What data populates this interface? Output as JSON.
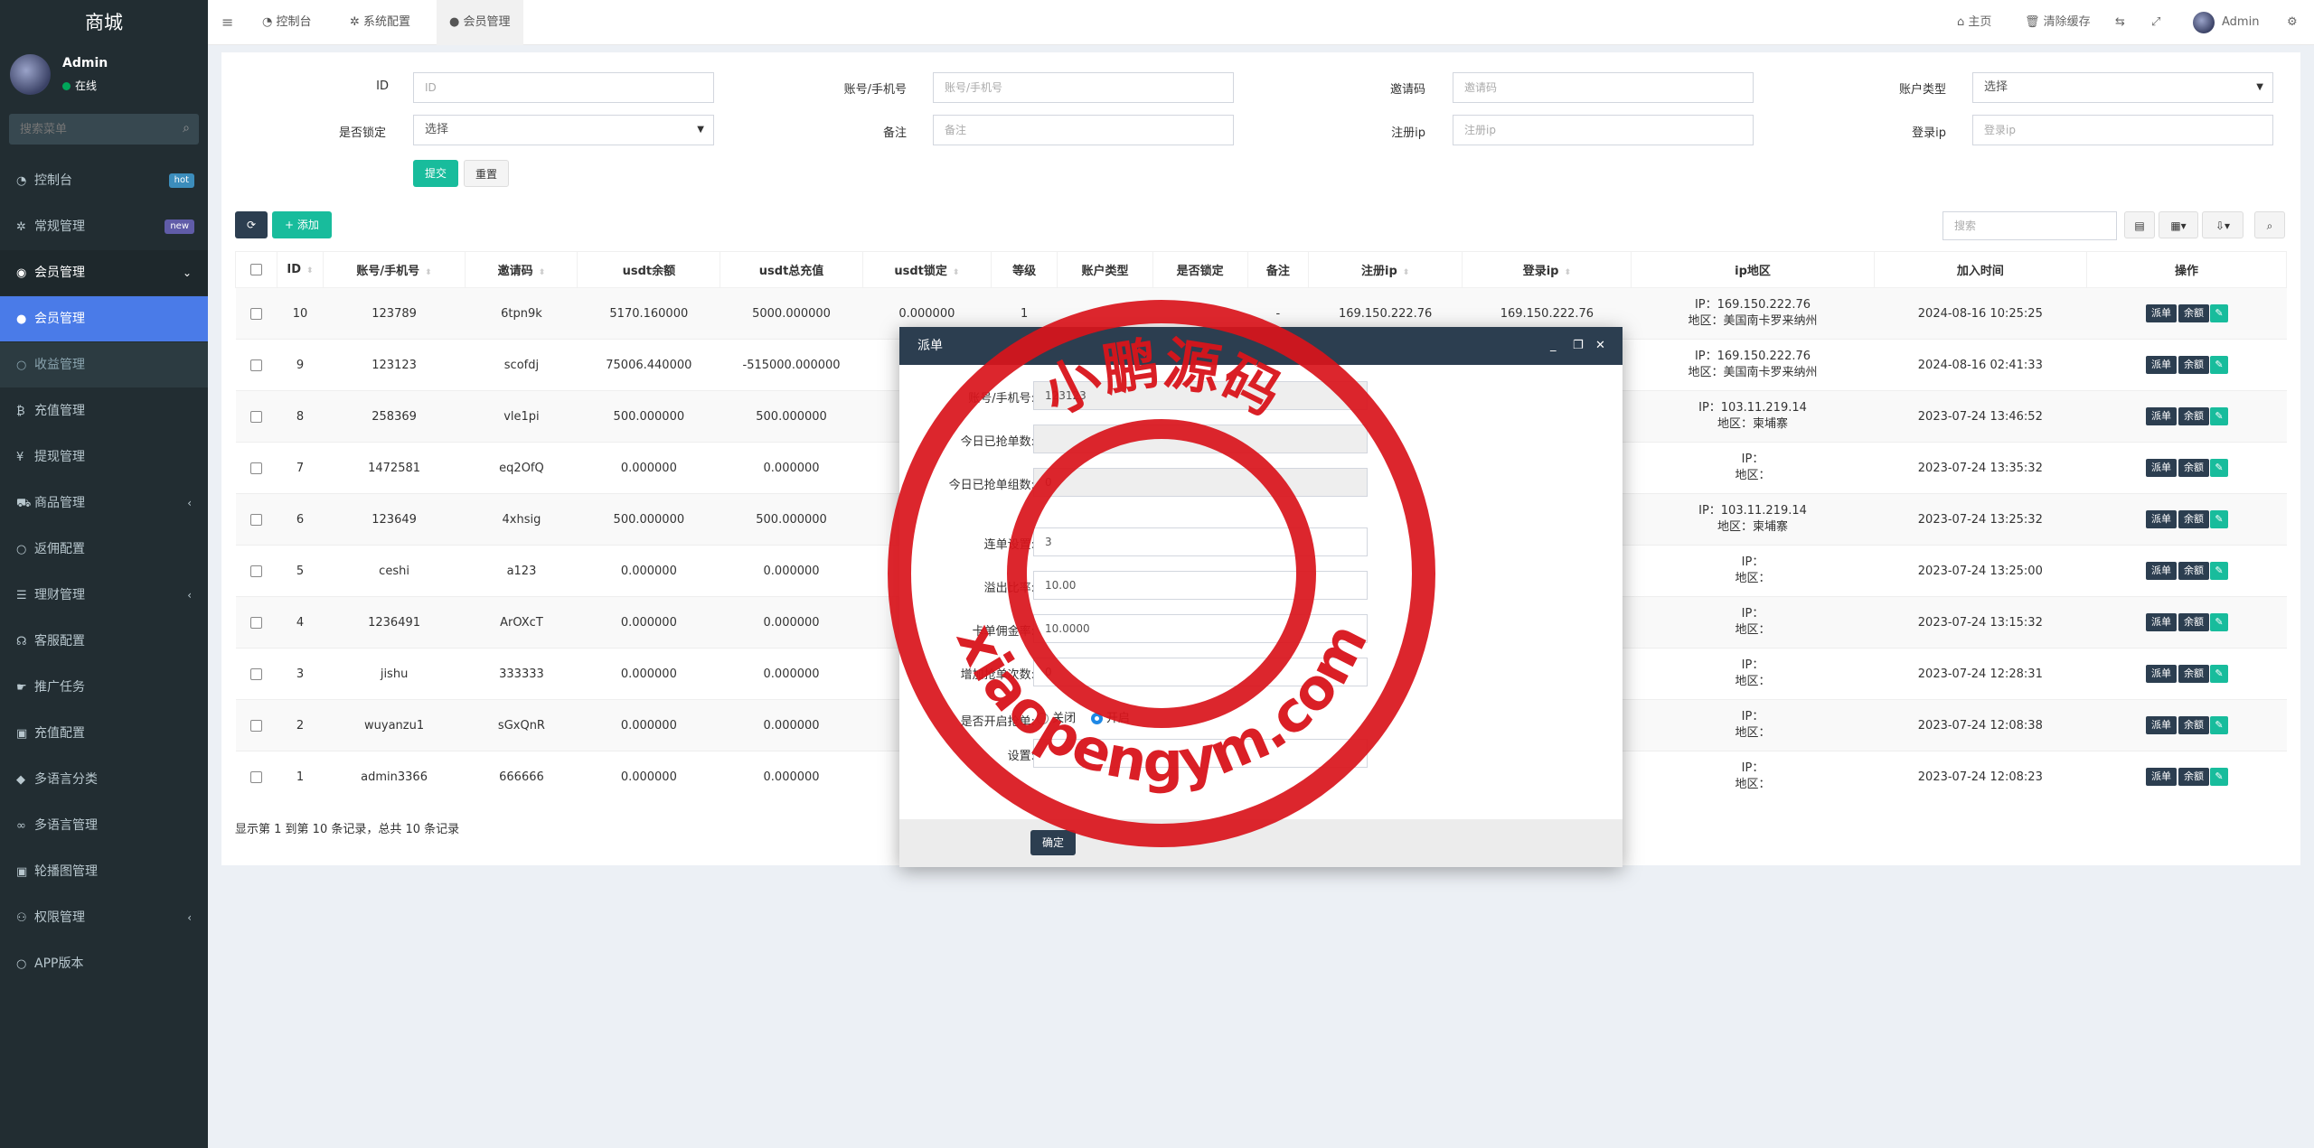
{
  "sidebar": {
    "logo": "商城",
    "user": {
      "name": "Admin",
      "status": "在线"
    },
    "search_placeholder": "搜索菜单",
    "items": [
      {
        "label": "控制台",
        "icon": "dashboard-icon",
        "badge": "hot",
        "badge_color": "#3c8dbc"
      },
      {
        "label": "常规管理",
        "icon": "cogs-icon",
        "badge": "new",
        "badge_color": "#605ca8"
      },
      {
        "label": "会员管理",
        "icon": "user-circle-icon",
        "expanded": true
      },
      {
        "label": "会员管理",
        "icon": "user-icon",
        "sub": true,
        "active": true
      },
      {
        "label": "收益管理",
        "icon": "circle-icon",
        "sub": true
      },
      {
        "label": "充值管理",
        "icon": "bitcoin-icon"
      },
      {
        "label": "提现管理",
        "icon": "yen-icon"
      },
      {
        "label": "商品管理",
        "icon": "cart-icon",
        "has_arrow": true
      },
      {
        "label": "返佣配置",
        "icon": "circle-icon"
      },
      {
        "label": "理财管理",
        "icon": "list-icon",
        "has_arrow": true
      },
      {
        "label": "客服配置",
        "icon": "headset-icon"
      },
      {
        "label": "推广任务",
        "icon": "hand-icon"
      },
      {
        "label": "充值配置",
        "icon": "image-icon"
      },
      {
        "label": "多语言分类",
        "icon": "tag-icon"
      },
      {
        "label": "多语言管理",
        "icon": "link-icon"
      },
      {
        "label": "轮播图管理",
        "icon": "image-icon"
      },
      {
        "label": "权限管理",
        "icon": "group-icon",
        "has_arrow": true
      },
      {
        "label": "APP版本",
        "icon": "circle-icon"
      }
    ]
  },
  "header": {
    "tabs": [
      {
        "label": "控制台",
        "icon": "dashboard-icon"
      },
      {
        "label": "系统配置",
        "icon": "gear-icon"
      },
      {
        "label": "会员管理",
        "icon": "user-icon",
        "active": true
      }
    ],
    "home": "主页",
    "clear_cache": "清除缓存",
    "admin": "Admin"
  },
  "filters": {
    "id": {
      "label": "ID",
      "placeholder": "ID"
    },
    "account": {
      "label": "账号/手机号",
      "placeholder": "账号/手机号"
    },
    "invite": {
      "label": "邀请码",
      "placeholder": "邀请码"
    },
    "account_type": {
      "label": "账户类型",
      "value": "选择"
    },
    "locked": {
      "label": "是否锁定",
      "value": "选择"
    },
    "remark": {
      "label": "备注",
      "placeholder": "备注"
    },
    "reg_ip": {
      "label": "注册ip",
      "placeholder": "注册ip"
    },
    "login_ip": {
      "label": "登录ip",
      "placeholder": "登录ip"
    },
    "submit": "提交",
    "reset": "重置"
  },
  "toolbar": {
    "add": "添加",
    "search_placeholder": "搜索"
  },
  "table": {
    "headers": [
      "ID",
      "账号/手机号",
      "邀请码",
      "usdt余额",
      "usdt总充值",
      "usdt锁定",
      "等级",
      "账户类型",
      "是否锁定",
      "备注",
      "注册ip",
      "登录ip",
      "ip地区",
      "加入时间",
      "操作"
    ],
    "rows": [
      {
        "id": "10",
        "account": "123789",
        "code": "6tpn9k",
        "balance": "5170.160000",
        "total": "5000.000000",
        "locked_amt": "0.000000",
        "reg_ip": "169.150.222.76",
        "login_ip": "169.150.222.76",
        "ip1": "IP：169.150.222.76",
        "ip2": "地区：美国南卡罗来纳州",
        "time": "2024-08-16 10:25:25"
      },
      {
        "id": "9",
        "account": "123123",
        "code": "scofdj",
        "balance": "75006.440000",
        "total": "-515000.000000",
        "locked_amt": "",
        "reg_ip": "",
        "login_ip": "76",
        "ip1": "IP：169.150.222.76",
        "ip2": "地区：美国南卡罗来纳州",
        "time": "2024-08-16 02:41:33"
      },
      {
        "id": "8",
        "account": "258369",
        "code": "vle1pi",
        "balance": "500.000000",
        "total": "500.000000",
        "locked_amt": "",
        "reg_ip": "",
        "login_ip": "14",
        "ip1": "IP：103.11.219.14",
        "ip2": "地区：柬埔寨",
        "time": "2023-07-24 13:46:52"
      },
      {
        "id": "7",
        "account": "1472581",
        "code": "eq2OfQ",
        "balance": "0.000000",
        "total": "0.000000",
        "locked_amt": "",
        "reg_ip": "",
        "login_ip": "",
        "ip1": "IP：",
        "ip2": "地区：",
        "time": "2023-07-24 13:35:32"
      },
      {
        "id": "6",
        "account": "123649",
        "code": "4xhsig",
        "balance": "500.000000",
        "total": "500.000000",
        "locked_amt": "",
        "reg_ip": "",
        "login_ip": "14",
        "ip1": "IP：103.11.219.14",
        "ip2": "地区：柬埔寨",
        "time": "2023-07-24 13:25:32"
      },
      {
        "id": "5",
        "account": "ceshi",
        "code": "a123",
        "balance": "0.000000",
        "total": "0.000000",
        "locked_amt": "",
        "reg_ip": "",
        "login_ip": "",
        "ip1": "IP：",
        "ip2": "地区：",
        "time": "2023-07-24 13:25:00"
      },
      {
        "id": "4",
        "account": "1236491",
        "code": "ArOXcT",
        "balance": "0.000000",
        "total": "0.000000",
        "locked_amt": "",
        "reg_ip": "",
        "login_ip": "",
        "ip1": "IP：",
        "ip2": "地区：",
        "time": "2023-07-24 13:15:32"
      },
      {
        "id": "3",
        "account": "jishu",
        "code": "333333",
        "balance": "0.000000",
        "total": "0.000000",
        "locked_amt": "",
        "reg_ip": "",
        "login_ip": "",
        "ip1": "IP：",
        "ip2": "地区：",
        "time": "2023-07-24 12:28:31"
      },
      {
        "id": "2",
        "account": "wuyanzu1",
        "code": "sGxQnR",
        "balance": "0.000000",
        "total": "0.000000",
        "locked_amt": "",
        "reg_ip": "",
        "login_ip": "14",
        "ip1": "IP：",
        "ip2": "地区：",
        "time": "2023-07-24 12:08:38"
      },
      {
        "id": "1",
        "account": "admin3366",
        "code": "666666",
        "balance": "0.000000",
        "total": "0.000000",
        "locked_amt": "",
        "reg_ip": "",
        "login_ip": "",
        "ip1": "IP：",
        "ip2": "地区：",
        "time": "2023-07-24 12:08:23"
      }
    ],
    "row0_extra": {
      "level": "1",
      "remark": "-"
    },
    "op_dispatch": "派单",
    "op_balance": "余额"
  },
  "pagination_text": "显示第 1 到第 10 条记录，总共 10 条记录",
  "modal": {
    "title": "派单",
    "fields": [
      {
        "label": "账号/手机号:",
        "value": "123123",
        "readonly": true
      },
      {
        "label": "今日已抢单数:",
        "value": "",
        "readonly": true
      },
      {
        "label": "今日已抢单组数:",
        "value": "0",
        "readonly": true
      },
      {
        "label": "连单设置:",
        "value": "3"
      },
      {
        "label": "溢出比率:",
        "value": "10.00"
      },
      {
        "label": "卡单佣金率:",
        "value": "10.0000"
      },
      {
        "label": "增加抢单次数:",
        "value": "0"
      }
    ],
    "toggle_label": "是否开启抢单:",
    "toggle_off": "关闭",
    "toggle_on": "开启",
    "last_label": "设置:",
    "confirm": "确定"
  },
  "watermark": {
    "text_cn": "小鹏源码",
    "text_en": "xiaopengym.com",
    "color": "#d9141b"
  }
}
